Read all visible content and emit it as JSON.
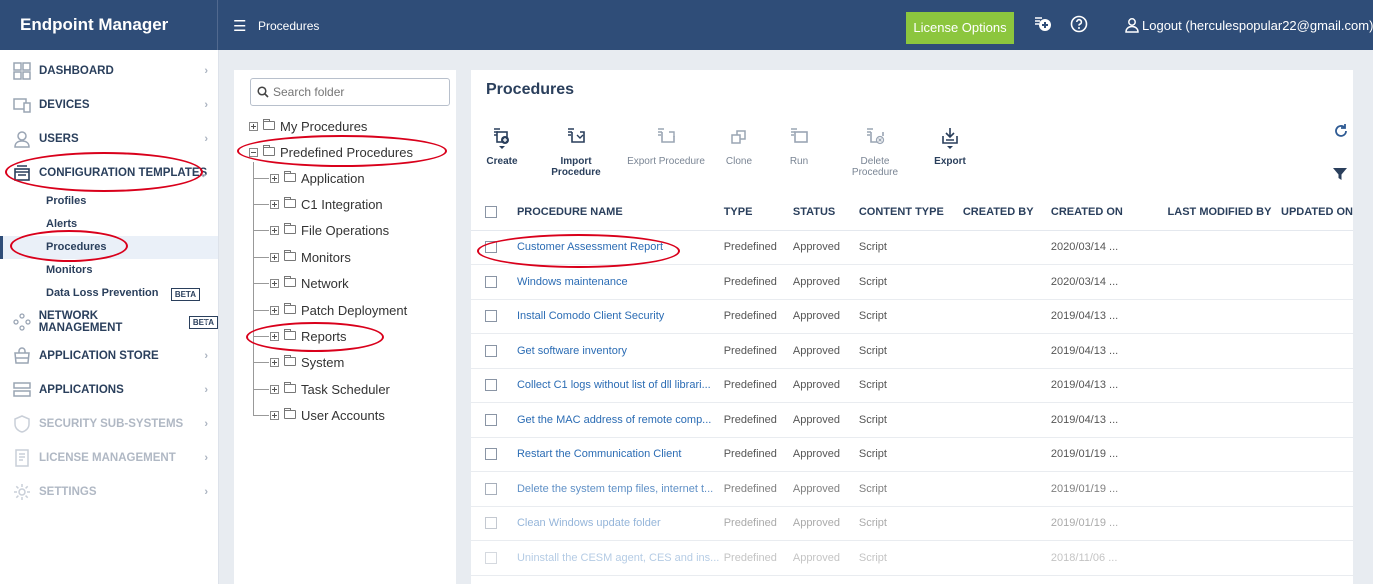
{
  "app": {
    "title": "Endpoint Manager"
  },
  "header": {
    "breadcrumb": "Procedures",
    "license_button": "License Options",
    "logout_label": "Logout (herculespopular22@gmail.com)",
    "accent_color": "#2f4d78",
    "license_color": "#8cc63e"
  },
  "sidebar": {
    "items": [
      {
        "label": "DASHBOARD",
        "icon": "dashboard-icon"
      },
      {
        "label": "DEVICES",
        "icon": "devices-icon"
      },
      {
        "label": "USERS",
        "icon": "user-icon"
      },
      {
        "label": "CONFIGURATION TEMPLATES",
        "icon": "templates-icon"
      },
      {
        "label": "NETWORK MANAGEMENT",
        "icon": "network-icon",
        "badge": "BETA"
      },
      {
        "label": "APPLICATION STORE",
        "icon": "store-icon"
      },
      {
        "label": "APPLICATIONS",
        "icon": "applications-icon"
      },
      {
        "label": "SECURITY SUB-SYSTEMS",
        "icon": "shield-icon"
      },
      {
        "label": "LICENSE MANAGEMENT",
        "icon": "license-icon"
      },
      {
        "label": "SETTINGS",
        "icon": "gear-icon"
      }
    ],
    "config_sub_items": [
      {
        "label": "Profiles"
      },
      {
        "label": "Alerts"
      },
      {
        "label": "Procedures"
      },
      {
        "label": "Monitors"
      },
      {
        "label": "Data Loss Prevention",
        "badge": "BETA"
      }
    ]
  },
  "tree": {
    "search_placeholder": "Search folder",
    "root_my": "My Procedures",
    "root_predefined": "Predefined Procedures",
    "children": [
      "Application",
      "C1 Integration",
      "File Operations",
      "Monitors",
      "Network",
      "Patch Deployment",
      "Reports",
      "System",
      "Task Scheduler",
      "User Accounts"
    ]
  },
  "main": {
    "title": "Procedures",
    "toolbar": {
      "create": "Create",
      "import": "Import Procedure",
      "export_procedure": "Export Procedure",
      "clone": "Clone",
      "run": "Run",
      "delete": "Delete Procedure",
      "export": "Export"
    },
    "columns": [
      "PROCEDURE NAME",
      "TYPE",
      "STATUS",
      "CONTENT TYPE",
      "CREATED BY",
      "CREATED ON",
      "LAST MODIFIED BY",
      "UPDATED ON"
    ],
    "rows": [
      {
        "name": "Customer Assessment Report",
        "type": "Predefined",
        "status": "Approved",
        "content_type": "Script",
        "created_by": "",
        "created_on": "2020/03/14 ...",
        "last_modified_by": "",
        "updated_on": ""
      },
      {
        "name": "Windows maintenance",
        "type": "Predefined",
        "status": "Approved",
        "content_type": "Script",
        "created_by": "",
        "created_on": "2020/03/14 ...",
        "last_modified_by": "",
        "updated_on": ""
      },
      {
        "name": "Install Comodo Client Security",
        "type": "Predefined",
        "status": "Approved",
        "content_type": "Script",
        "created_by": "",
        "created_on": "2019/04/13 ...",
        "last_modified_by": "",
        "updated_on": ""
      },
      {
        "name": "Get software inventory",
        "type": "Predefined",
        "status": "Approved",
        "content_type": "Script",
        "created_by": "",
        "created_on": "2019/04/13 ...",
        "last_modified_by": "",
        "updated_on": ""
      },
      {
        "name": "Collect C1 logs without list of dll librari...",
        "type": "Predefined",
        "status": "Approved",
        "content_type": "Script",
        "created_by": "",
        "created_on": "2019/04/13 ...",
        "last_modified_by": "",
        "updated_on": ""
      },
      {
        "name": "Get the MAC address of remote comp...",
        "type": "Predefined",
        "status": "Approved",
        "content_type": "Script",
        "created_by": "",
        "created_on": "2019/04/13 ...",
        "last_modified_by": "",
        "updated_on": ""
      },
      {
        "name": "Restart the Communication Client",
        "type": "Predefined",
        "status": "Approved",
        "content_type": "Script",
        "created_by": "",
        "created_on": "2019/01/19 ...",
        "last_modified_by": "",
        "updated_on": ""
      },
      {
        "name": "Delete the system temp files, internet t...",
        "type": "Predefined",
        "status": "Approved",
        "content_type": "Script",
        "created_by": "",
        "created_on": "2019/01/19 ...",
        "last_modified_by": "",
        "updated_on": ""
      },
      {
        "name": "Clean Windows update folder",
        "type": "Predefined",
        "status": "Approved",
        "content_type": "Script",
        "created_by": "",
        "created_on": "2019/01/19 ...",
        "last_modified_by": "",
        "updated_on": ""
      },
      {
        "name": "Uninstall the CESM agent, CES and ins...",
        "type": "Predefined",
        "status": "Approved",
        "content_type": "Script",
        "created_by": "",
        "created_on": "2018/11/06 ...",
        "last_modified_by": "",
        "updated_on": ""
      }
    ]
  }
}
